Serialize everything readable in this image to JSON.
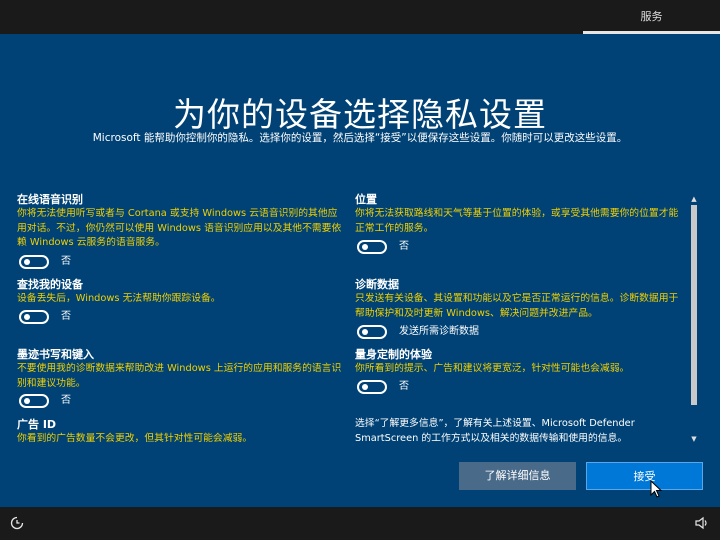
{
  "topbar": {
    "service_tab": "服务"
  },
  "header": {
    "title": "为你的设备选择隐私设置",
    "subtitle": "Microsoft 能帮助你控制你的隐私。选择你的设置，然后选择“接受”以便保存这些设置。你随时可以更改这些设置。"
  },
  "settings_left": [
    {
      "title": "在线语音识别",
      "desc": "你将无法使用听写或者与 Cortana 或支持 Windows 云语音识别的其他应用对话。不过，你仍然可以使用 Windows 语音识别应用以及其他不需要依赖 Windows 云服务的语音服务。",
      "toggle_label": "否",
      "on": false
    },
    {
      "title": "查找我的设备",
      "desc": "设备丢失后，Windows 无法帮助你跟踪设备。",
      "toggle_label": "否",
      "on": false
    },
    {
      "title": "墨迹书写和键入",
      "desc": "不要使用我的诊断数据来帮助改进 Windows 上运行的应用和服务的语言识别和建议功能。",
      "toggle_label": "否",
      "on": false
    },
    {
      "title": "广告 ID",
      "desc": "你看到的广告数量不会更改，但其针对性可能会减弱。"
    }
  ],
  "settings_right": [
    {
      "title": "位置",
      "desc": "你将无法获取路线和天气等基于位置的体验，或享受其他需要你的位置才能正常工作的服务。",
      "toggle_label": "否",
      "on": false
    },
    {
      "title": "诊断数据",
      "desc": "只发送有关设备、其设置和功能以及它是否正常运行的信息。诊断数据用于帮助保护和及时更新 Windows、解决问题并改进产品。",
      "toggle_label": "发送所需诊断数据",
      "on": false
    },
    {
      "title": "量身定制的体验",
      "desc": "你所看到的提示、广告和建议将更宽泛，针对性可能也会减弱。",
      "toggle_label": "否",
      "on": false
    }
  ],
  "more_info": "选择“了解更多信息”，了解有关上述设置、Microsoft Defender SmartScreen 的工作方式以及相关的数据传输和使用的信息。",
  "buttons": {
    "learn_more": "了解详细信息",
    "accept": "接受"
  },
  "icons": {
    "ease_of_access": "ease-of-access-icon",
    "volume": "volume-icon"
  },
  "colors": {
    "background": "#004275",
    "description_text": "#f0d000",
    "accept_button": "#0078d7",
    "learn_button": "#4a6a8a",
    "bars": "#1a1a1a"
  }
}
